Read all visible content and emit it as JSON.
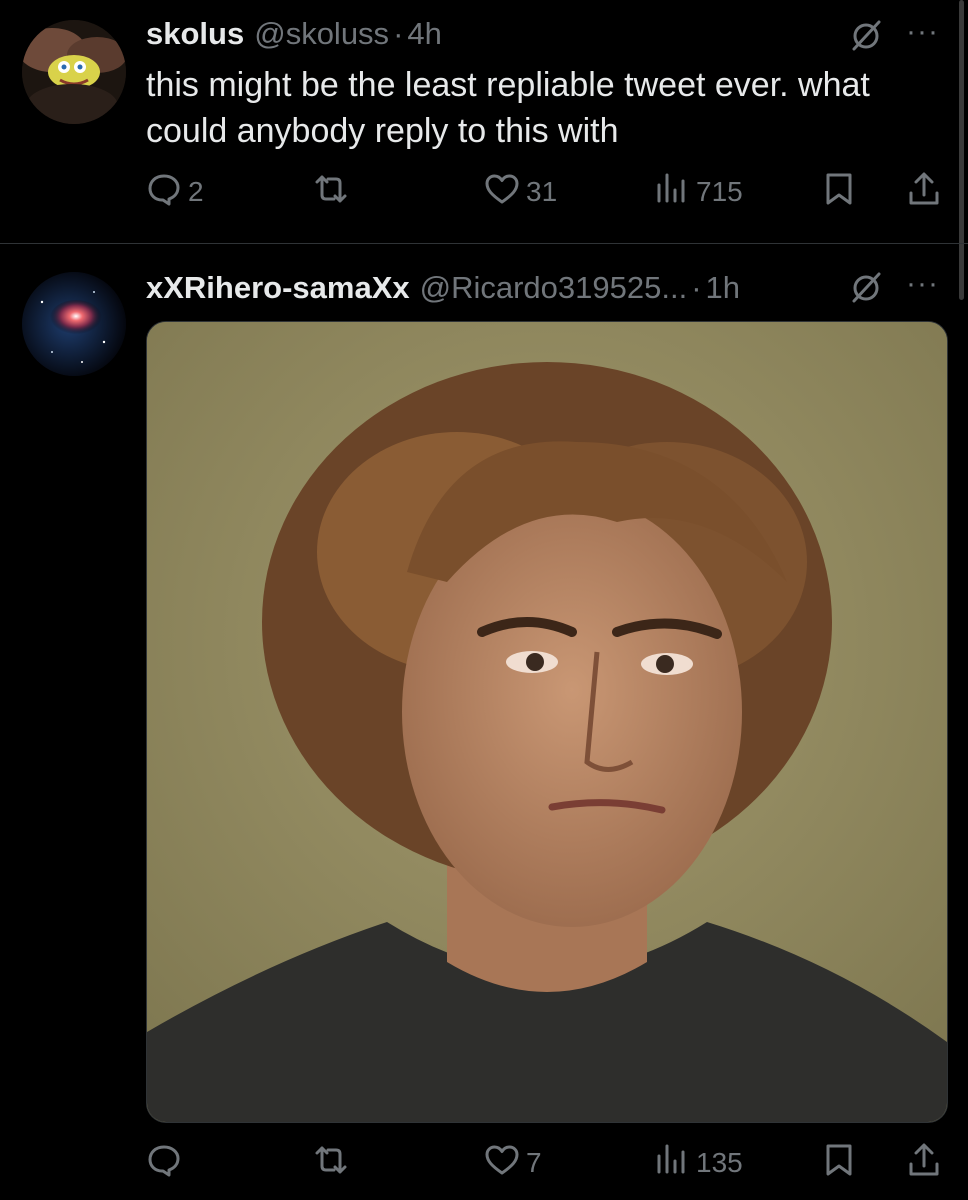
{
  "tweets": [
    {
      "display_name": "skolus",
      "handle": "@skoluss",
      "separator": "·",
      "time": "4h",
      "text": "this might be the least repliable tweet ever. what could anybody reply to this with",
      "replies": "2",
      "reposts": "",
      "likes": "31",
      "views": "715"
    },
    {
      "display_name": "xXRihero-samaXx",
      "handle": "@Ricardo319525...",
      "separator": "·",
      "time": "1h",
      "replies": "",
      "reposts": "",
      "likes": "7",
      "views": "135"
    }
  ],
  "more_label": "···",
  "colors": {
    "background": "#000000",
    "text": "#e7e9ea",
    "secondary": "#71767b",
    "divider": "#2f3336"
  }
}
